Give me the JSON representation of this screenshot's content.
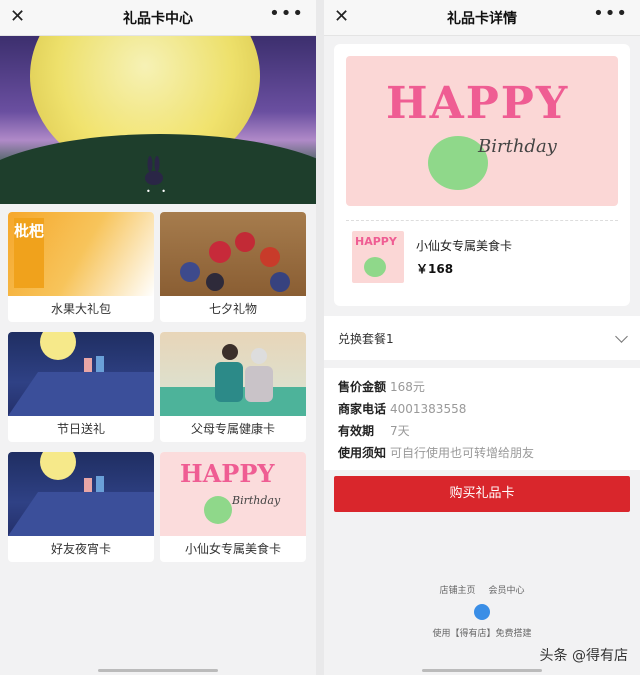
{
  "left": {
    "title": "礼品卡中心",
    "close_icon": "close-icon",
    "more_icon": "more-icon",
    "products": [
      {
        "label": "水果大礼包",
        "tag": "枇杷"
      },
      {
        "label": "七夕礼物"
      },
      {
        "label": "节日送礼"
      },
      {
        "label": "父母专属健康卡"
      },
      {
        "label": "好友夜宵卡"
      },
      {
        "label": "小仙女专属美食卡"
      }
    ]
  },
  "right": {
    "title": "礼品卡详情",
    "hero": {
      "text1": "HAPPY",
      "text2": "Birthday"
    },
    "product": {
      "name": "小仙女专属美食卡",
      "price": "￥168",
      "thumb_text": "HAPPY"
    },
    "combo": "兑换套餐1",
    "info": [
      {
        "key": "售价金额",
        "value": "168元"
      },
      {
        "key": "商家电话",
        "value": "4001383558"
      },
      {
        "key": "有效期",
        "value": "7天"
      },
      {
        "key": "使用须知",
        "value": "可自行使用也可转增给朋友"
      }
    ],
    "buy_label": "购买礼品卡",
    "footer_links": [
      "店铺主页",
      "会员中心"
    ],
    "footer_note": "使用【得有店】免费搭建"
  },
  "watermark": "头条 @得有店",
  "colors": {
    "accent": "#d9262c"
  }
}
